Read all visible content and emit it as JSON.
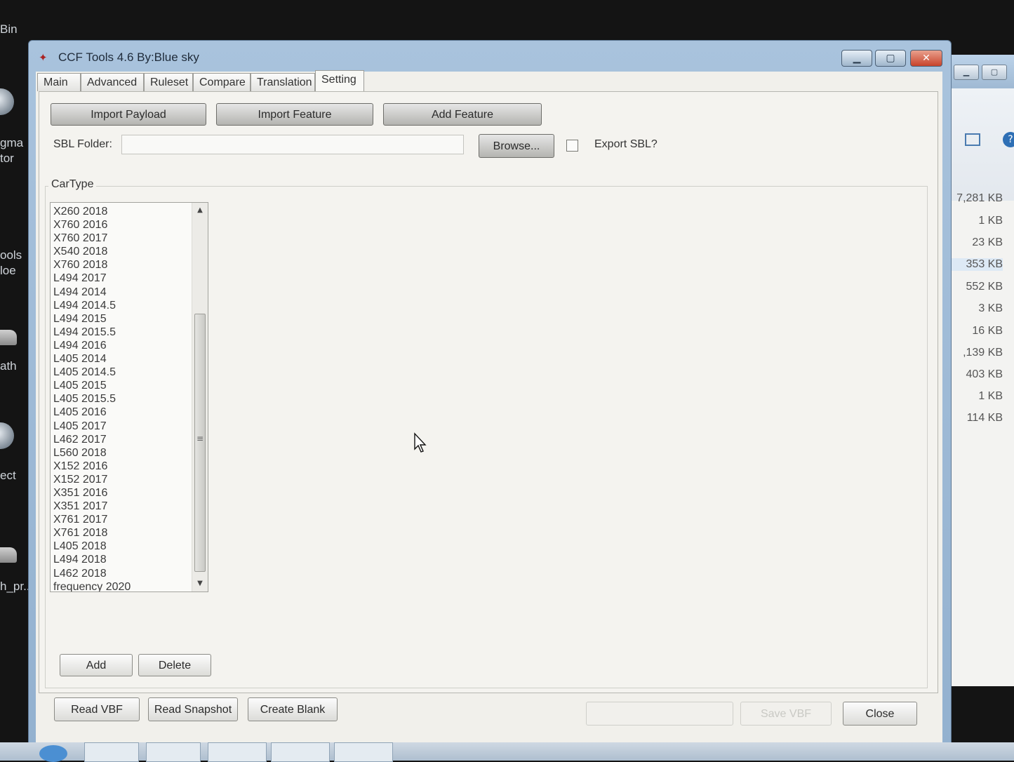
{
  "desktop": {
    "labels": [
      "Bin",
      "gma",
      "tor",
      "ools",
      "loe",
      "ath",
      "ect",
      "h_pr..."
    ]
  },
  "background_window": {
    "file_sizes": [
      "7,281 KB",
      "1 KB",
      "23 KB",
      "353 KB",
      "552 KB",
      "3 KB",
      "16 KB",
      ",139 KB",
      "403 KB",
      "1 KB",
      "114 KB"
    ]
  },
  "window": {
    "title": "CCF Tools 4.6   By:Blue sky",
    "minimize_icon": "minimize-icon",
    "maximize_icon": "maximize-icon",
    "close_icon": "close-icon"
  },
  "tabs": [
    {
      "label": "Main"
    },
    {
      "label": "Advanced"
    },
    {
      "label": "Ruleset"
    },
    {
      "label": "Compare"
    },
    {
      "label": "Translation"
    },
    {
      "label": "Setting",
      "active": true
    }
  ],
  "setting": {
    "import_payload": "Import Payload",
    "import_feature": "Import Feature",
    "add_feature": "Add Feature",
    "sbl_folder_label": "SBL Folder:",
    "sbl_folder_value": "",
    "browse": "Browse...",
    "export_sbl_label": "Export SBL?",
    "export_sbl_checked": false,
    "cartype_label": "CarType",
    "cartype_items": [
      "X260 2018",
      "X760 2016",
      "X760 2017",
      "X540 2018",
      "X760 2018",
      "L494 2017",
      "L494 2014",
      "L494 2014.5",
      "L494 2015",
      "L494 2015.5",
      "L494 2016",
      "L405 2014",
      "L405 2014.5",
      "L405 2015",
      "L405 2015.5",
      "L405 2016",
      "L405 2017",
      "L462 2017",
      "L560 2018",
      "X152 2016",
      "X152 2017",
      "X351 2016",
      "X351 2017",
      "X761 2017",
      "X761 2018",
      "L405 2018",
      "L494 2018",
      "L462 2018",
      "frequency  2020"
    ],
    "add": "Add",
    "delete": "Delete"
  },
  "footer": {
    "read_vbf": "Read VBF",
    "read_snapshot": "Read Snapshot",
    "create_blank": "Create Blank",
    "save_vbf": "Save VBF",
    "close": "Close"
  },
  "colors": {
    "titlebar": "#a9c3dd",
    "close_button": "#c8432b",
    "panel_bg": "#f4f3ef"
  }
}
